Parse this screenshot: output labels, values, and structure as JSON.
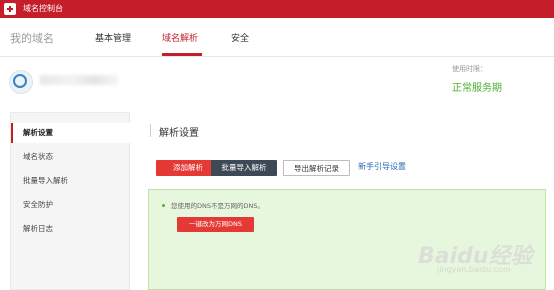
{
  "topbar": {
    "title": "域名控制台"
  },
  "nav": {
    "brand": "我的域名",
    "tabs": [
      {
        "label": "基本管理"
      },
      {
        "label": "域名解析"
      },
      {
        "label": "安全"
      }
    ]
  },
  "service": {
    "label": "使用时限：",
    "status": "正常服务期"
  },
  "sidebar": {
    "items": [
      {
        "label": "解析设置"
      },
      {
        "label": "域名状态"
      },
      {
        "label": "批量导入解析"
      },
      {
        "label": "安全防护"
      },
      {
        "label": "解析日志"
      }
    ]
  },
  "main": {
    "title": "解析设置",
    "buttons": {
      "add": "添加解析",
      "batch_import": "批量导入解析",
      "export": "导出解析记录"
    },
    "guide_link": "新手引导设置",
    "notice": {
      "text": "您使用的DNS不是万网的DNS。",
      "button": "一键改为万网DNS"
    }
  },
  "watermark": {
    "text": "Baidu经验",
    "sub": "jingyan.baidu.com"
  },
  "colors": {
    "brand_red": "#c41e2a",
    "button_red": "#e53935",
    "status_green": "#4caf2e",
    "notice_bg": "#e7f7dd"
  }
}
